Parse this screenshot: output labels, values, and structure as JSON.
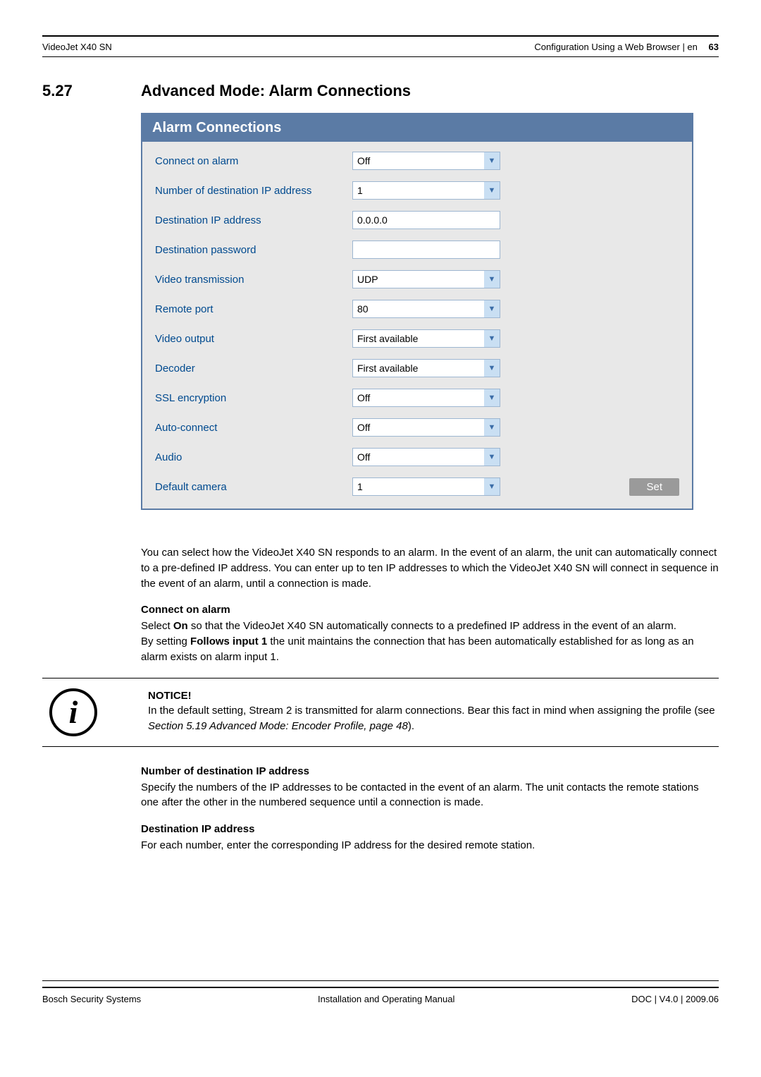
{
  "header": {
    "product": "VideoJet X40 SN",
    "breadcrumb": "Configuration Using a Web Browser | en",
    "page": "63"
  },
  "section": {
    "number": "5.27",
    "title": "Advanced Mode: Alarm Connections"
  },
  "panel": {
    "title": "Alarm Connections",
    "rows": [
      {
        "label": "Connect on alarm",
        "value": "Off",
        "type": "select"
      },
      {
        "label": "Number of destination IP address",
        "value": "1",
        "type": "select"
      },
      {
        "label": "Destination IP address",
        "value": "0.0.0.0",
        "type": "input"
      },
      {
        "label": "Destination password",
        "value": "",
        "type": "input"
      },
      {
        "label": "Video transmission",
        "value": "UDP",
        "type": "select"
      },
      {
        "label": "Remote port",
        "value": "80",
        "type": "select"
      },
      {
        "label": "Video output",
        "value": "First available",
        "type": "select"
      },
      {
        "label": "Decoder",
        "value": "First available",
        "type": "select"
      },
      {
        "label": "SSL encryption",
        "value": "Off",
        "type": "select"
      },
      {
        "label": "Auto-connect",
        "value": "Off",
        "type": "select"
      },
      {
        "label": "Audio",
        "value": "Off",
        "type": "select"
      },
      {
        "label": "Default camera",
        "value": "1",
        "type": "select",
        "has_button": true
      }
    ],
    "button": "Set"
  },
  "paragraphs": {
    "intro": "You can select how the VideoJet X40 SN responds to an alarm. In the event of an alarm, the unit can automatically connect to a pre-defined IP address. You can enter up to ten IP addresses to which the VideoJet X40 SN will connect in sequence in the event of an alarm, until a connection is made.",
    "connect_h": "Connect on alarm",
    "connect_p1a": "Select ",
    "connect_p1_bold": "On",
    "connect_p1b": " so that the VideoJet X40 SN automatically connects to a predefined IP address in the event of an alarm.",
    "connect_p2a": "By setting ",
    "connect_p2_bold": "Follows input 1",
    "connect_p2b": " the unit maintains the connection that has been automatically established for as long as an alarm exists on alarm input 1.",
    "notice_label": "NOTICE!",
    "notice_body_a": "In the default setting, Stream 2 is transmitted for alarm connections. Bear this fact in mind when assigning the profile (see ",
    "notice_body_ref": "Section 5.19 Advanced Mode: Encoder Profile, page 48",
    "notice_body_b": ").",
    "num_h": "Number of destination IP address",
    "num_p": "Specify the numbers of the IP addresses to be contacted in the event of an alarm. The unit contacts the remote stations one after the other in the numbered sequence until a connection is made.",
    "dest_h": "Destination IP address",
    "dest_p": "For each number, enter the corresponding IP address for the desired remote station."
  },
  "footer": {
    "left": "Bosch Security Systems",
    "center": "Installation and Operating Manual",
    "right": "DOC | V4.0 | 2009.06"
  }
}
